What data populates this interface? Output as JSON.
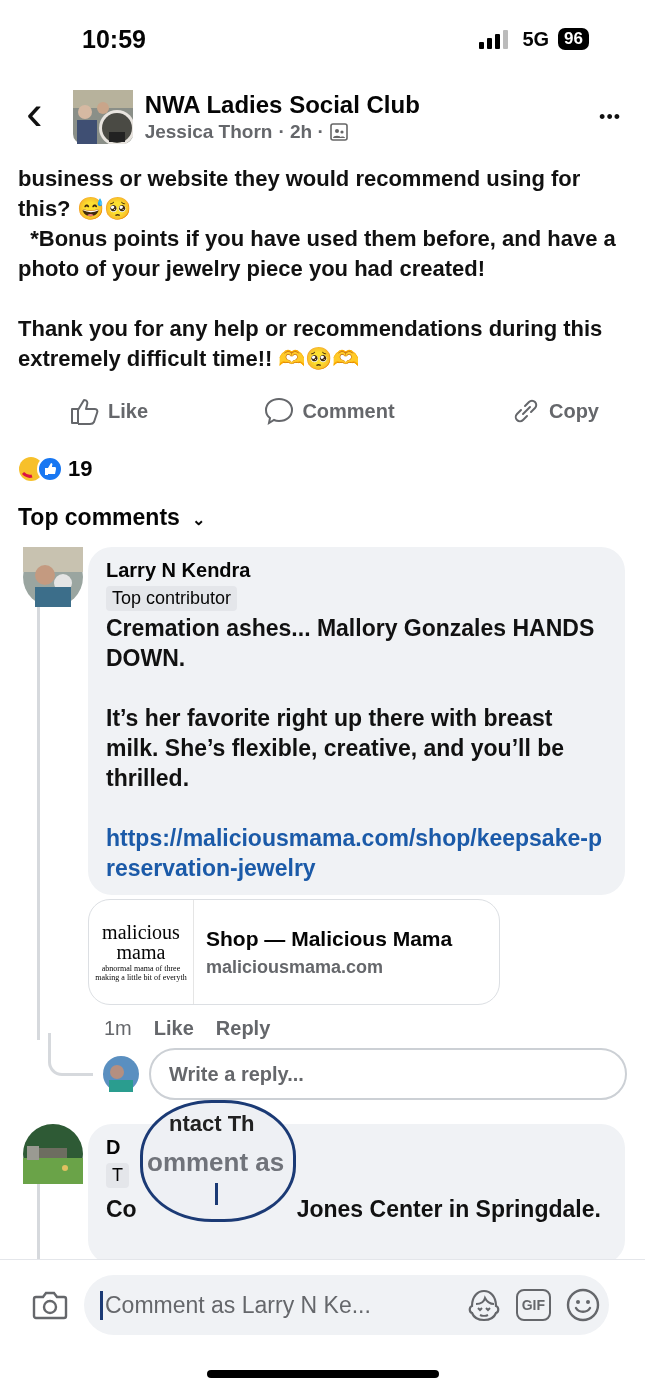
{
  "status_bar": {
    "time": "10:59",
    "network": "5G",
    "battery": "96"
  },
  "header": {
    "back": "‹",
    "group": "NWA Ladies Social Club",
    "author": "Jessica Thorn",
    "time": "· 2h ·",
    "more": "•••"
  },
  "post": {
    "paragraphs": [
      "business or website they would recommend using for this? 😅🥺",
      "  *Bonus points if you have used them before, and have a photo of your jewelry piece you had created!",
      "Thank you for any help or recommendations during this extremely difficult time!! 🫶🥺🫶"
    ]
  },
  "actions": [
    {
      "kind": "like",
      "label": "Like"
    },
    {
      "kind": "comment",
      "label": "Comment"
    },
    {
      "kind": "copy",
      "label": "Copy"
    }
  ],
  "reactions": {
    "count": "19"
  },
  "sort": {
    "label": "Top comments",
    "caret": "⌄"
  },
  "comments": [
    {
      "author": "Larry N Kendra",
      "badge": "Top contributor",
      "paragraphs": [
        "Cremation ashes... Mallory Gonzales HANDS DOWN.",
        "It’s her favorite right up there with breast milk. She’s flexible, creative, and you’ll be thrilled."
      ],
      "link": "https://maliciousmama.com/shop/keepsake-preservation-jewelry",
      "preview": {
        "logo_top": "malicious",
        "logo_bottom": "mama",
        "logo_tagline": "abnormal mama of three making a little bit of everyth",
        "title": "Shop — Malicious Mama",
        "domain": "maliciousmama.com"
      },
      "time": "1m",
      "like": "Like",
      "reply": "Reply"
    }
  ],
  "reply_field": {
    "placeholder": "Write a reply..."
  },
  "next_comment": {
    "author": "D",
    "badge": "T",
    "text_start": "Co",
    "text_end": "Jones Center in Springdale."
  },
  "magnifier": {
    "top_text": "ntact Th",
    "text": "omment as"
  },
  "composer": {
    "placeholder": "Comment as Larry N Ke...",
    "gif": "GIF"
  }
}
